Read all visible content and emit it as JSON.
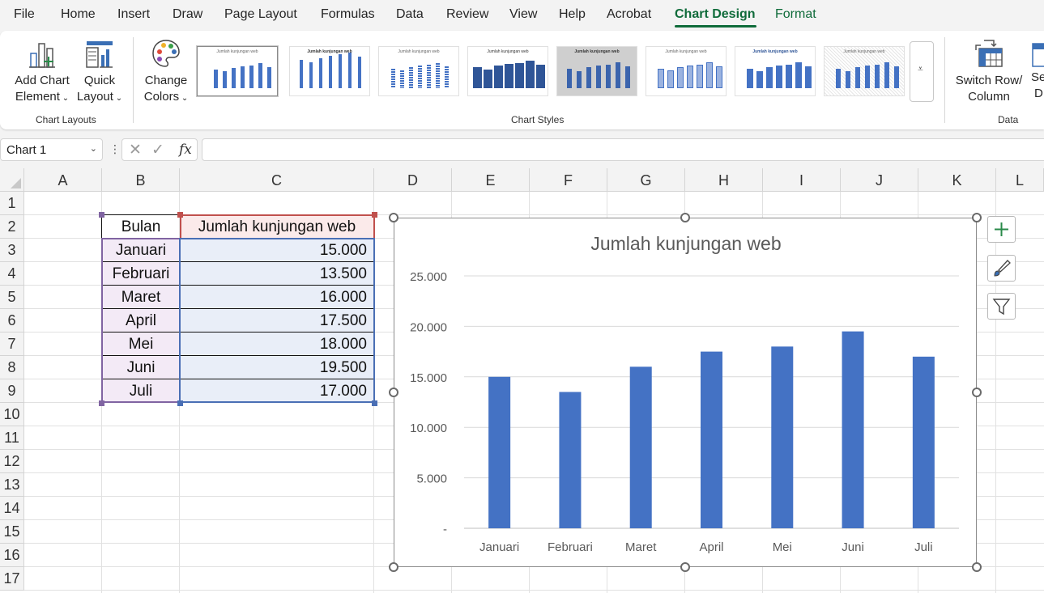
{
  "menu": {
    "tabs": [
      "File",
      "Home",
      "Insert",
      "Draw",
      "Page Layout",
      "Formulas",
      "Data",
      "Review",
      "View",
      "Help",
      "Acrobat",
      "Chart Design",
      "Format"
    ],
    "active": "Chart Design"
  },
  "ribbon": {
    "add_chart_element": "Add Chart",
    "add_chart_element_2": "Element",
    "quick_layout": "Quick",
    "quick_layout_2": "Layout",
    "change_colors": "Change",
    "change_colors_2": "Colors",
    "switch_row_column": "Switch Row/",
    "switch_row_column_2": "Column",
    "select_data": "Se",
    "select_data_2": "D",
    "group_chart_layouts": "Chart Layouts",
    "group_chart_styles": "Chart Styles",
    "group_data": "Data"
  },
  "formula_bar": {
    "name_box": "Chart 1",
    "fx": "fx",
    "value": ""
  },
  "grid": {
    "columns": [
      "A",
      "B",
      "C",
      "D",
      "E",
      "F",
      "G",
      "H",
      "I",
      "J",
      "K",
      "L"
    ],
    "rows": [
      "1",
      "2",
      "3",
      "4",
      "5",
      "6",
      "7",
      "8",
      "9",
      "10",
      "11",
      "12",
      "13",
      "14",
      "15",
      "16",
      "17"
    ]
  },
  "table": {
    "header_b": "Bulan",
    "header_c": "Jumlah kunjungan web",
    "rows": [
      {
        "bulan": "Januari",
        "jumlah": "15.000"
      },
      {
        "bulan": "Februari",
        "jumlah": "13.500"
      },
      {
        "bulan": "Maret",
        "jumlah": "16.000"
      },
      {
        "bulan": "April",
        "jumlah": "17.500"
      },
      {
        "bulan": "Mei",
        "jumlah": "18.000"
      },
      {
        "bulan": "Juni",
        "jumlah": "19.500"
      },
      {
        "bulan": "Juli",
        "jumlah": "17.000"
      }
    ]
  },
  "chart_data": {
    "type": "bar",
    "title": "Jumlah kunjungan web",
    "categories": [
      "Januari",
      "Februari",
      "Maret",
      "April",
      "Mei",
      "Juni",
      "Juli"
    ],
    "values": [
      15000,
      13500,
      16000,
      17500,
      18000,
      19500,
      17000
    ],
    "ylim": [
      0,
      25000
    ],
    "yticks": [
      0,
      5000,
      10000,
      15000,
      20000,
      25000
    ],
    "ytick_labels": [
      "-",
      "5.000",
      "10.000",
      "15.000",
      "20.000",
      "25.000"
    ],
    "xlabel": "",
    "ylabel": "",
    "grid": true,
    "bar_color": "#4472c4"
  },
  "colors": {
    "accent": "#0f6b3a",
    "bar": "#4472c4"
  }
}
